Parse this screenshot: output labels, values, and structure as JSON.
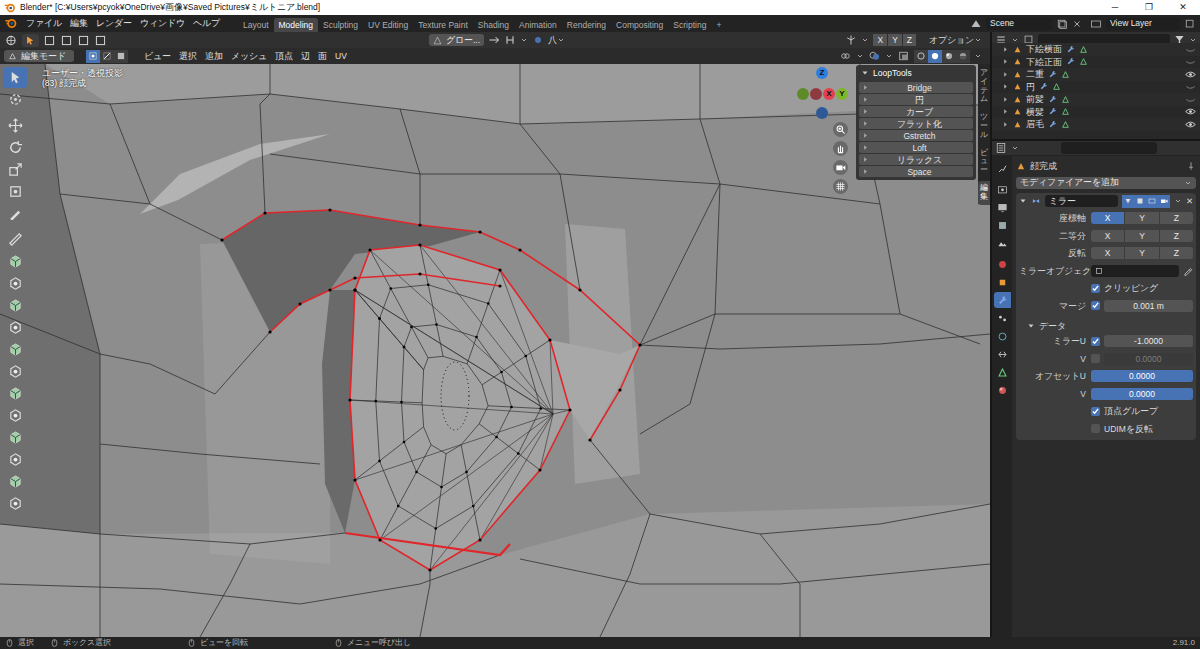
{
  "window": {
    "title": "Blender* [C:¥Users¥pcyok¥OneDrive¥画像¥Saved Pictures¥ミルトニア.blend]",
    "controls": [
      "─",
      "❐",
      "✕"
    ]
  },
  "menu": [
    "ファイル",
    "編集",
    "レンダー",
    "ウィンドウ",
    "ヘルプ"
  ],
  "workspaces": [
    {
      "label": "Layout",
      "selected": false
    },
    {
      "label": "Modeling",
      "selected": true
    },
    {
      "label": "Sculpting",
      "selected": false
    },
    {
      "label": "UV Editing",
      "selected": false
    },
    {
      "label": "Texture Paint",
      "selected": false
    },
    {
      "label": "Shading",
      "selected": false
    },
    {
      "label": "Animation",
      "selected": false
    },
    {
      "label": "Rendering",
      "selected": false
    },
    {
      "label": "Compositing",
      "selected": false
    },
    {
      "label": "Scripting",
      "selected": false
    }
  ],
  "add_workspace": "+",
  "scene": "Scene",
  "view_layer": "View Layer",
  "tool_header": {
    "orientation": "グロー...",
    "falloff": "八",
    "mirror_axes": [
      {
        "label": "X",
        "selected": false
      },
      {
        "label": "Y",
        "selected": false
      },
      {
        "label": "Z",
        "selected": false
      }
    ],
    "options": "オプション"
  },
  "viewport_header": {
    "mode": "編集モード",
    "select_modes": [
      {
        "selected": true
      },
      {
        "selected": false
      },
      {
        "selected": false
      }
    ],
    "menus": [
      "ビュー",
      "選択",
      "追加",
      "メッシュ",
      "頂点",
      "辺",
      "面",
      "UV"
    ],
    "shading": [
      {
        "selected": false
      },
      {
        "selected": true
      },
      {
        "selected": false
      },
      {
        "selected": false
      }
    ]
  },
  "viewport": {
    "view_name": "ユーザー・透視投影",
    "object_info": "(83) 顔完成",
    "tools": [
      {
        "selected": true
      },
      {
        "selected": false
      },
      {
        "selected": false
      },
      {
        "selected": false
      },
      {
        "selected": false
      },
      {
        "selected": false
      },
      {
        "selected": false
      },
      {
        "selected": false
      },
      {
        "selected": false
      },
      {
        "selected": false
      },
      {
        "selected": false
      },
      {
        "selected": false
      },
      {
        "selected": false
      },
      {
        "selected": false
      },
      {
        "selected": false
      },
      {
        "selected": false
      },
      {
        "selected": false
      },
      {
        "selected": false
      },
      {
        "selected": false
      },
      {
        "selected": false
      }
    ],
    "gizmo": [
      {
        "label": "Z",
        "color": "#2f7fe0"
      },
      {
        "label": "X",
        "color": "#e2404e"
      },
      {
        "label": "Y",
        "color": "#7eb72a"
      }
    ],
    "sidebar_tabs": [
      {
        "label": "アイテム",
        "selected": false
      },
      {
        "label": "ツール",
        "selected": false
      },
      {
        "label": "ビュー",
        "selected": false
      },
      {
        "label": "編集",
        "selected": true
      }
    ]
  },
  "looptools": {
    "title": "LoopTools",
    "expanded": true,
    "items": [
      "Bridge",
      "円",
      "カーブ",
      "フラット化",
      "Gstretch",
      "Loft",
      "リラックス",
      "Space"
    ]
  },
  "outliner": {
    "items": [
      {
        "label": "下絵横面",
        "visible": false
      },
      {
        "label": "下絵正面",
        "visible": false
      },
      {
        "label": "二重",
        "visible": true
      },
      {
        "label": "円",
        "visible": false
      },
      {
        "label": "前髪",
        "visible": false
      },
      {
        "label": "横髪",
        "visible": true
      },
      {
        "label": "眉毛",
        "visible": true
      }
    ]
  },
  "properties": {
    "object_name": "顔完成",
    "add_modifier": "モディファイアーを追加",
    "tabs": [
      {
        "selected": false
      },
      {
        "selected": false
      },
      {
        "selected": false
      },
      {
        "selected": false
      },
      {
        "selected": false
      },
      {
        "selected": false
      },
      {
        "selected": false
      },
      {
        "selected": true
      },
      {
        "selected": false
      },
      {
        "selected": false
      },
      {
        "selected": false
      },
      {
        "selected": false
      },
      {
        "selected": false
      }
    ],
    "modifier": {
      "name": "ミラー",
      "expanded": true,
      "toggles": [
        {
          "on": true
        },
        {
          "on": true
        },
        {
          "on": true
        },
        {
          "on": true
        }
      ],
      "delete": "✕"
    },
    "axis_rows": [
      {
        "label": "座標軸",
        "axes": [
          {
            "label": "X",
            "selected": true
          },
          {
            "label": "Y",
            "selected": false
          },
          {
            "label": "Z",
            "selected": false
          }
        ]
      },
      {
        "label": "二等分",
        "axes": [
          {
            "label": "X",
            "selected": false
          },
          {
            "label": "Y",
            "selected": false
          },
          {
            "label": "Z",
            "selected": false
          }
        ]
      },
      {
        "label": "反転",
        "axes": [
          {
            "label": "X",
            "selected": false
          },
          {
            "label": "Y",
            "selected": false
          },
          {
            "label": "Z",
            "selected": false
          }
        ]
      }
    ],
    "mirror_object": {
      "label": "ミラーオブジェク..."
    },
    "clipping": {
      "label": "クリッピング",
      "checked": true
    },
    "merge": {
      "label": "マージ",
      "checked": true,
      "value": "0.001 m"
    },
    "data_panel": {
      "title": "データ",
      "expanded": true
    },
    "mirror_u": {
      "label": "ミラーU",
      "checked": true,
      "value": "-1.0000"
    },
    "mirror_v": {
      "label": "V",
      "checked": false,
      "disabled": true,
      "value": "0.0000"
    },
    "offset_u": {
      "label": "オフセットU",
      "value": "0.0000",
      "level": 1
    },
    "offset_v": {
      "label": "V",
      "value": "0.0000",
      "level": 1
    },
    "vertex_groups": {
      "label": "頂点グループ",
      "checked": true
    },
    "flip_udim": {
      "label": "UDIMを反転",
      "checked": false
    }
  },
  "status_bar": {
    "items": [
      "選択",
      "ボックス選択",
      "ビューを回転",
      "メニュー呼び出し"
    ],
    "version": "2.91.0"
  }
}
